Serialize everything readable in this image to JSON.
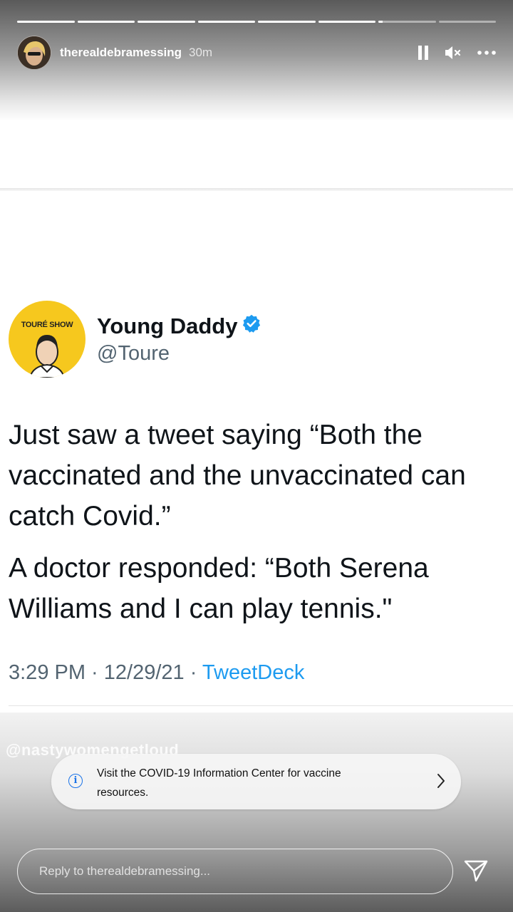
{
  "story": {
    "segments_total": 8,
    "segments_done": 6,
    "current_progress": 0.08
  },
  "header": {
    "username": "therealdebramessing",
    "time": "30m",
    "icons": [
      "pause-icon",
      "mute-icon",
      "more-icon"
    ]
  },
  "tweet": {
    "avatar_brand": "TOURÉ SHOW",
    "name": "Young Daddy",
    "verified": true,
    "handle": "@Toure",
    "paragraph1_line1": "Just saw a tweet saying “Both the",
    "paragraph1_line2": "vaccinated and the unvaccinated can",
    "paragraph1_line3": "catch Covid.”",
    "paragraph2_line1": "A doctor responded: “Both Serena",
    "paragraph2_line2": "Williams and I can play tennis.\"",
    "meta_time": "3:29 PM · 12/29/21 · ",
    "meta_source": "TweetDeck"
  },
  "watermark": "@nastywomengetloud",
  "covid_banner": {
    "text_line1": "Visit the COVID-19 Information Center for vaccine",
    "text_line2": "resources."
  },
  "reply": {
    "placeholder": "Reply to therealdebramessing..."
  },
  "colors": {
    "verified": "#1d9bf0",
    "link": "#1d9bf0",
    "info_icon": "#1a73e8",
    "avatar_bg": "#f6c81e"
  }
}
